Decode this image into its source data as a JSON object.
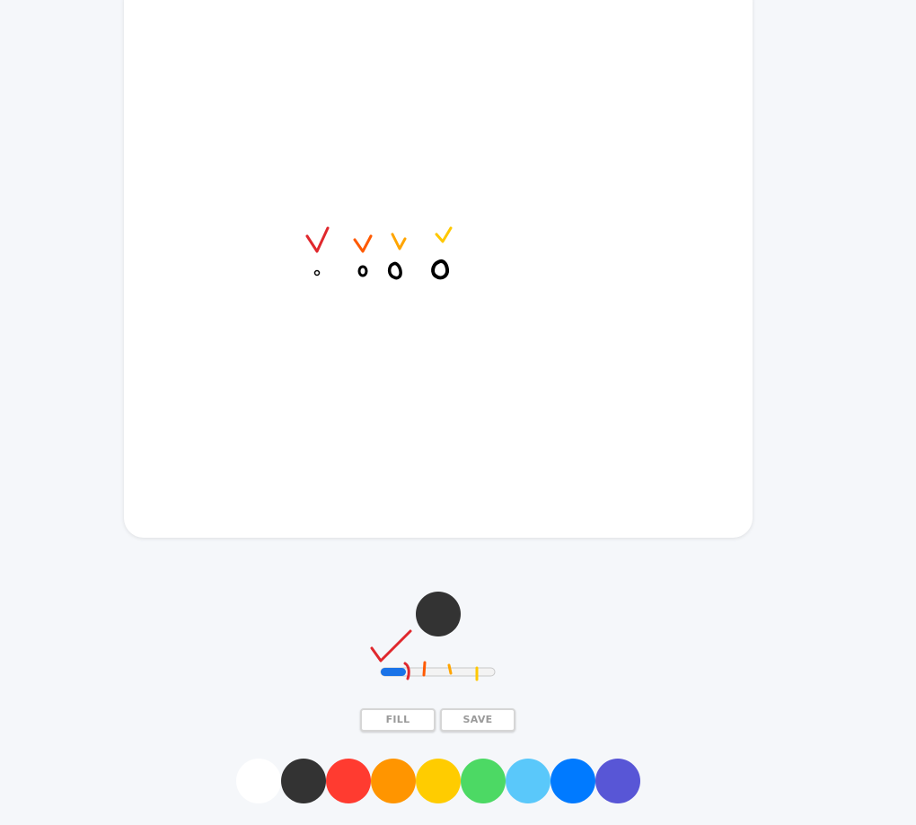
{
  "canvas": {
    "background_color": "#ffffff",
    "strokes": [
      {
        "shape": "check-mark",
        "color": "#e0282d"
      },
      {
        "shape": "check-mark",
        "color": "#ff5a00"
      },
      {
        "shape": "check-mark",
        "color": "#ffa500"
      },
      {
        "shape": "check-mark",
        "color": "#ffc800"
      },
      {
        "shape": "dot",
        "color": "#000000"
      },
      {
        "shape": "dot",
        "color": "#000000"
      },
      {
        "shape": "dot",
        "color": "#000000"
      },
      {
        "shape": "dot",
        "color": "#000000"
      }
    ]
  },
  "brush": {
    "current_color": "#333333",
    "size_value": 20,
    "size_min": 1,
    "size_max": 100
  },
  "buttons": {
    "fill_label": "FILL",
    "save_label": "SAVE"
  },
  "palette": [
    {
      "name": "white",
      "color": "#ffffff"
    },
    {
      "name": "black",
      "color": "#333333"
    },
    {
      "name": "red",
      "color": "#ff3b30"
    },
    {
      "name": "orange",
      "color": "#ff9500"
    },
    {
      "name": "yellow",
      "color": "#ffcc00"
    },
    {
      "name": "green",
      "color": "#4cd964"
    },
    {
      "name": "light-blue",
      "color": "#5ac8fa"
    },
    {
      "name": "blue",
      "color": "#007aff"
    },
    {
      "name": "purple",
      "color": "#5856d6"
    }
  ],
  "accent_color": "#1a73e8"
}
